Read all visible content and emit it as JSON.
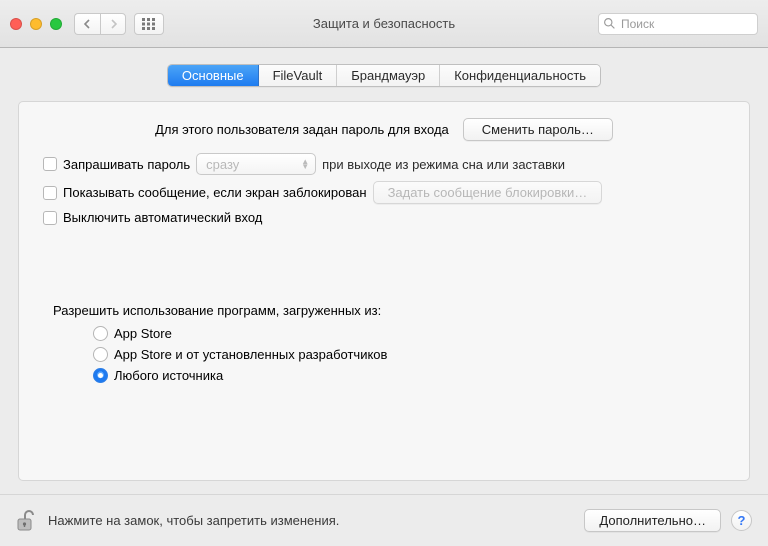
{
  "window": {
    "title": "Защита и безопасность",
    "search_placeholder": "Поиск"
  },
  "tabs": [
    {
      "label": "Основные",
      "active": true
    },
    {
      "label": "FileVault",
      "active": false
    },
    {
      "label": "Брандмауэр",
      "active": false
    },
    {
      "label": "Конфиденциальность",
      "active": false
    }
  ],
  "general": {
    "password_set_label": "Для этого пользователя задан пароль для входа",
    "change_password_btn": "Сменить пароль…",
    "require_password": {
      "checkbox_label": "Запрашивать пароль",
      "delay_value": "сразу",
      "tail": "при выходе из режима сна или заставки",
      "checked": false
    },
    "show_message": {
      "checkbox_label": "Показывать сообщение, если экран заблокирован",
      "set_message_btn": "Задать сообщение блокировки…",
      "checked": false
    },
    "disable_autologin": {
      "checkbox_label": "Выключить автоматический вход",
      "checked": false
    },
    "allow_apps": {
      "section_label": "Разрешить использование программ, загруженных из:",
      "options": [
        {
          "label": "App Store",
          "selected": false
        },
        {
          "label": "App Store и от установленных разработчиков",
          "selected": false
        },
        {
          "label": "Любого источника",
          "selected": true
        }
      ]
    }
  },
  "footer": {
    "lock_text": "Нажмите на замок, чтобы запретить изменения.",
    "advanced_btn": "Дополнительно…",
    "help_label": "?"
  }
}
